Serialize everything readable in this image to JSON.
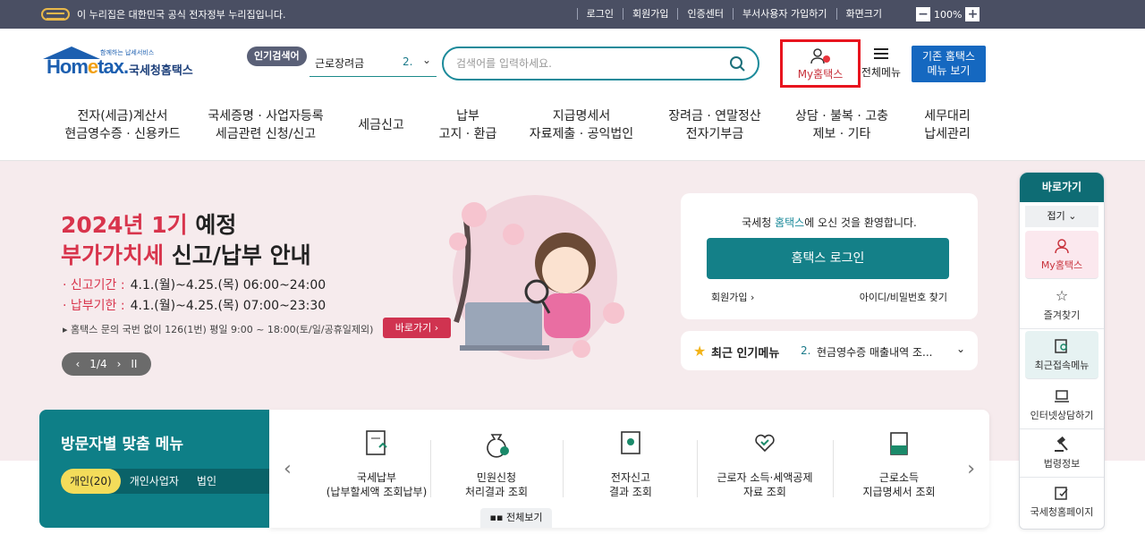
{
  "topbar": {
    "gov_notice": "이 누리집은 대한민국 공식 전자정부 누리집입니다.",
    "links": [
      "로그인",
      "회원가입",
      "인증센터",
      "부서사용자 가입하기",
      "화면크기"
    ],
    "zoom": "100%",
    "zoom_minus": "−",
    "zoom_plus": "+"
  },
  "header": {
    "logo_small": "함께하는 납세서비스",
    "logo_home": "Hom",
    "logo_e": "e",
    "logo_tax": "tax.",
    "logo_kr": "국세청홈택스",
    "popular_badge": "인기검색어",
    "popular_term": "근로장려금",
    "popular_rank": "2.",
    "search_placeholder": "검색어를 입력하세요.",
    "my_hometax": "My홈택스",
    "all_menu": "전체메뉴",
    "old_menu_line1": "기존 홈택스",
    "old_menu_line2": "메뉴 보기"
  },
  "gnb": [
    {
      "l1": "전자(세금)계산서",
      "l2": "현금영수증 · 신용카드"
    },
    {
      "l1": "국세증명 · 사업자등록",
      "l2": "세금관련 신청/신고"
    },
    {
      "l1": "세금신고",
      "l2": ""
    },
    {
      "l1": "납부",
      "l2": "고지 · 환급"
    },
    {
      "l1": "지급명세서",
      "l2": "자료제출 · 공익법인"
    },
    {
      "l1": "장려금 · 연말정산",
      "l2": "전자기부금"
    },
    {
      "l1": "상담 · 불복 · 고충",
      "l2": "제보 · 기타"
    },
    {
      "l1": "세무대리",
      "l2": "납세관리"
    }
  ],
  "hero": {
    "title1_red": "2024년 1기",
    "title1_black": "예정",
    "title2_red": "부가가치세",
    "title2_black": "신고/납부 안내",
    "line1_label": "· 신고기간 :",
    "line1_value": "4.1.(월)~4.25.(목) 06:00~24:00",
    "line2_label": "· 납부기한 :",
    "line2_value": "4.1.(월)~4.25.(목) 07:00~23:30",
    "note": "▸ 홈택스 문의 국번 없이 126(1번) 평일 9:00 ~ 18:00(토/일/공휴일제외)",
    "go_button": "바로가기 ›",
    "pager_prev": "‹",
    "pager_text": "1/4",
    "pager_next": "›",
    "pager_pause": "II"
  },
  "login": {
    "welcome_pre": "국세청 ",
    "welcome_brand": "홈택스",
    "welcome_post": "에 오신 것을 환영합니다.",
    "login_button": "홈택스 로그인",
    "join": "회원가입 ›",
    "find": "아이디/비밀번호 찾기"
  },
  "recent_menu": {
    "title": "최근 인기메뉴",
    "rank": "2.",
    "value": "현금영수증 매출내역 조...",
    "chevron": "⌄"
  },
  "visitor": {
    "title": "방문자별 맞춤 메뉴",
    "tabs": [
      "개인(20)",
      "개인사업자",
      "법인"
    ]
  },
  "quick_menu": {
    "items": [
      {
        "l1": "국세납부",
        "l2": "(납부할세액 조회납부)"
      },
      {
        "l1": "민원신청",
        "l2": "처리결과 조회"
      },
      {
        "l1": "전자신고",
        "l2": "결과 조회"
      },
      {
        "l1": "근로자 소득·세액공제",
        "l2": "자료 조회"
      },
      {
        "l1": "근로소득",
        "l2": "지급명세서 조회"
      }
    ],
    "all_view": "전체보기",
    "prev": "‹",
    "next": "›"
  },
  "side_bar": {
    "title": "바로가기",
    "fold": "접기 ⌄",
    "items": [
      "My홈택스",
      "즐겨찾기",
      "최근접속메뉴",
      "인터넷상담하기",
      "법령정보",
      "국세청홈페이지"
    ]
  }
}
